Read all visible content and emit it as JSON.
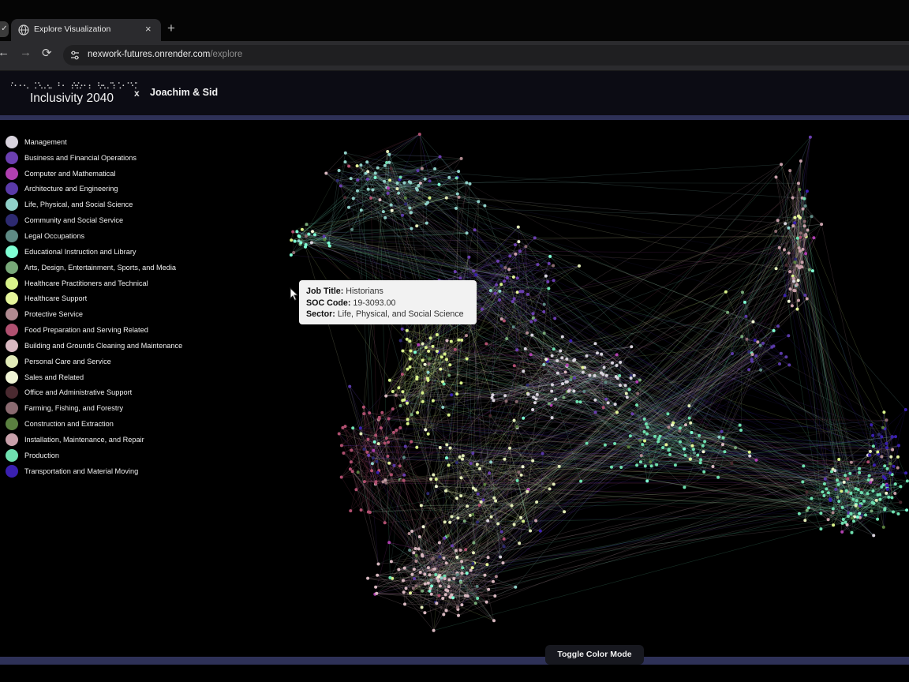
{
  "browser": {
    "tab_dropdown_glyph": "✓",
    "tab_title": "Explore Visualization",
    "tab_close_glyph": "×",
    "new_tab_glyph": "+",
    "url_host": "nexwork-futures.onrender.com",
    "url_path": "/explore",
    "back_glyph": "←",
    "forward_glyph": "→",
    "reload_glyph": "⟳",
    "icons": [
      "globe-icon",
      "site-info-icon"
    ]
  },
  "header": {
    "brand_title": "Inclusivity 2040",
    "separator": "x",
    "collaborators": "Joachim & Sid"
  },
  "legend": {
    "items": [
      {
        "label": "Management",
        "color": "#d8d3dd"
      },
      {
        "label": "Business and Financial Operations",
        "color": "#6b3fb0"
      },
      {
        "label": "Computer and Mathematical",
        "color": "#b040b0"
      },
      {
        "label": "Architecture and Engineering",
        "color": "#5a3aa8"
      },
      {
        "label": "Life, Physical, and Social Science",
        "color": "#8fd0c8"
      },
      {
        "label": "Community and Social Service",
        "color": "#2d2a70"
      },
      {
        "label": "Legal Occupations",
        "color": "#5e8a84"
      },
      {
        "label": "Educational Instruction and Library",
        "color": "#7fffd4"
      },
      {
        "label": "Arts, Design, Entertainment, Sports, and Media",
        "color": "#78a878"
      },
      {
        "label": "Healthcare Practitioners and Technical",
        "color": "#d8f28a"
      },
      {
        "label": "Healthcare Support",
        "color": "#e5f59a"
      },
      {
        "label": "Protective Service",
        "color": "#b08a90"
      },
      {
        "label": "Food Preparation and Serving Related",
        "color": "#b05070"
      },
      {
        "label": "Building and Grounds Cleaning and Maintenance",
        "color": "#d8b8c0"
      },
      {
        "label": "Personal Care and Service",
        "color": "#e2ebb8"
      },
      {
        "label": "Sales and Related",
        "color": "#f0f5d5"
      },
      {
        "label": "Office and Administrative Support",
        "color": "#4a2a30"
      },
      {
        "label": "Farming, Fishing, and Forestry",
        "color": "#8a6a70"
      },
      {
        "label": "Construction and Extraction",
        "color": "#5a8040"
      },
      {
        "label": "Installation, Maintenance, and Repair",
        "color": "#c8a0aa"
      },
      {
        "label": "Production",
        "color": "#6fe0b0"
      },
      {
        "label": "Transportation and Material Moving",
        "color": "#3a20b0"
      }
    ]
  },
  "tooltip": {
    "job_title_label": "Job Title:",
    "job_title": "Historians",
    "soc_code_label": "SOC Code:",
    "soc_code": "19-3093.00",
    "sector_label": "Sector:",
    "sector": "Life, Physical, and Social Science"
  },
  "footer": {
    "toggle_label": "Toggle Color Mode"
  }
}
